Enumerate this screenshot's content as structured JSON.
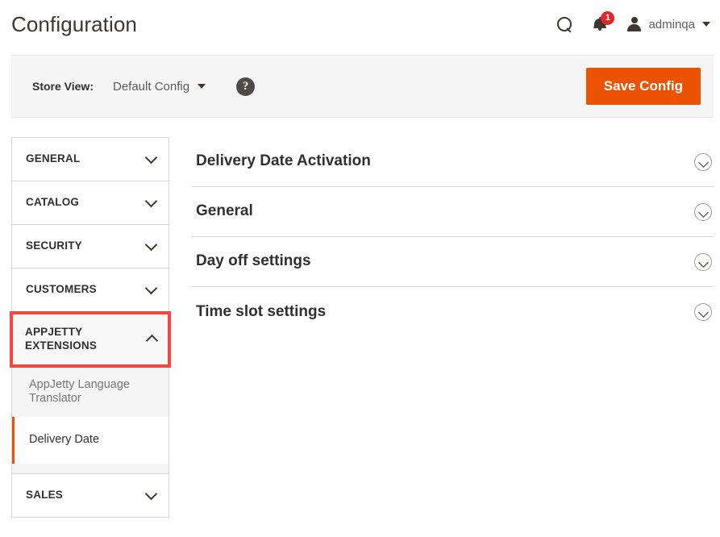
{
  "header": {
    "title": "Configuration",
    "search_icon": "search-icon",
    "notifications": {
      "icon": "bell-icon",
      "badge_count": "1",
      "badge_color": "#e22626"
    },
    "user": {
      "avatar_icon": "user-avatar-icon",
      "name": "adminqa",
      "caret_icon": "caret-down-icon"
    }
  },
  "store_bar": {
    "label": "Store View:",
    "selected_store": "Default Config",
    "caret_icon": "caret-down-icon",
    "help_icon": "help-question-icon",
    "help_glyph": "?",
    "save_label": "Save Config",
    "save_color": "#eb5202"
  },
  "sidebar": {
    "sections": [
      {
        "label": "GENERAL",
        "chevron": "chevron-down-icon",
        "expanded": false
      },
      {
        "label": "CATALOG",
        "chevron": "chevron-down-icon",
        "expanded": false
      },
      {
        "label": "SECURITY",
        "chevron": "chevron-down-icon",
        "expanded": false
      },
      {
        "label": "CUSTOMERS",
        "chevron": "chevron-down-icon",
        "expanded": false
      },
      {
        "label": "APPJETTY EXTENSIONS",
        "chevron": "chevron-up-icon",
        "expanded": true,
        "highlighted": true,
        "highlight_color": "#f4473f"
      },
      {
        "label": "SALES",
        "chevron": "chevron-down-icon",
        "expanded": false
      }
    ],
    "subitems": [
      {
        "label": "AppJetty Language Translator",
        "active": false
      },
      {
        "label": "Delivery Date",
        "active": true,
        "active_color": "#eb5202"
      }
    ]
  },
  "main": {
    "accordions": [
      {
        "title": "Delivery Date Activation",
        "icon": "chevron-down-circle-icon",
        "expanded": false
      },
      {
        "title": "General",
        "icon": "chevron-down-circle-icon",
        "expanded": false
      },
      {
        "title": "Day off settings",
        "icon": "chevron-down-circle-icon",
        "expanded": false
      },
      {
        "title": "Time slot settings",
        "icon": "chevron-down-circle-icon",
        "expanded": false
      }
    ]
  }
}
